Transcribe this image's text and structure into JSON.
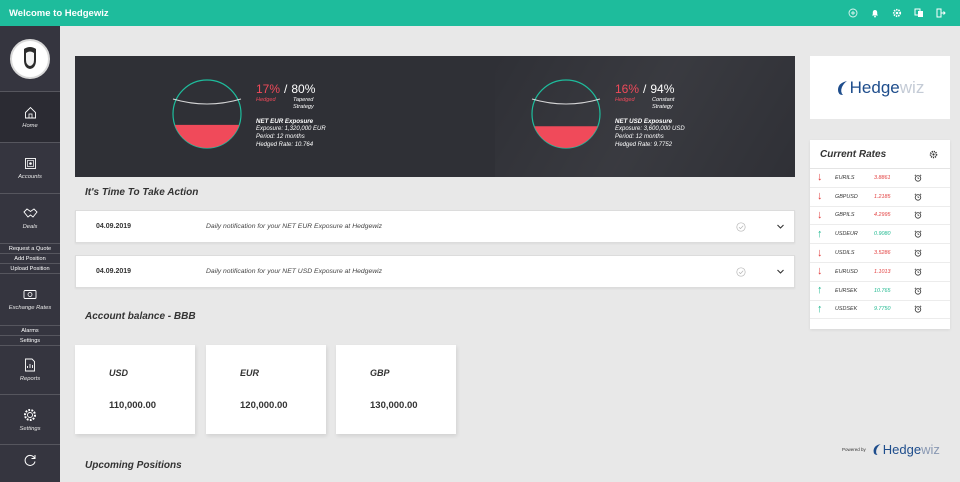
{
  "app": {
    "title": "Welcome to Hedgewiz"
  },
  "topbar_icons": [
    "add-circle-icon",
    "bell-icon",
    "gear-icon",
    "windows-icon",
    "logout-icon"
  ],
  "sidebar": {
    "items": [
      {
        "label": "Home",
        "icon": "home-icon",
        "active": true
      },
      {
        "label": "Accounts",
        "icon": "safe-icon"
      },
      {
        "label": "Deals",
        "icon": "handshake-icon"
      }
    ],
    "deal_sub": [
      "Request a Quote",
      "Add Position",
      "Upload Position"
    ],
    "exchange": {
      "label": "Exchange Rates",
      "icon": "money-icon"
    },
    "exchange_sub": [
      "Alarms",
      "Settings"
    ],
    "reports": {
      "label": "Reports",
      "icon": "report-icon"
    },
    "settings": {
      "label": "Settings",
      "icon": "gear-icon"
    }
  },
  "exposures": [
    {
      "hedged_pct": "17%",
      "strategy_pct": "80%",
      "hedged_label": "Hedged",
      "strategy_label": "Tapered Strategy",
      "gauge_fill": 0.17,
      "title": "NET EUR Exposure",
      "exposure": "Exposure: 1,320,000  EUR",
      "period": "Period: 12 months",
      "rate": "Hedged Rate: 10.764"
    },
    {
      "hedged_pct": "16%",
      "strategy_pct": "94%",
      "hedged_label": "Hedged",
      "strategy_label": "Constant Strategy",
      "gauge_fill": 0.16,
      "title": "NET USD Exposure",
      "exposure": "Exposure: 3,600,000  USD",
      "period": "Period: 12 months",
      "rate": "Hedged Rate: 9.7752"
    }
  ],
  "action": {
    "title": "It's Time To Take Action",
    "notifications": [
      {
        "date": "04.09.2019",
        "message": "Daily notification for your NET EUR Exposure at Hedgewiz"
      },
      {
        "date": "04.09.2019",
        "message": "Daily notification for your NET USD Exposure at Hedgewiz"
      }
    ]
  },
  "balance": {
    "title": "Account balance - BBB",
    "cards": [
      {
        "currency": "USD",
        "amount": "110,000.00"
      },
      {
        "currency": "EUR",
        "amount": "120,000.00"
      },
      {
        "currency": "GBP",
        "amount": "130,000.00"
      }
    ]
  },
  "upcoming": {
    "title": "Upcoming Positions"
  },
  "logo": {
    "main": "Hedge",
    "accent": "wiz"
  },
  "rates": {
    "title": "Current Rates",
    "rows": [
      {
        "pair": "EURILS",
        "value": "3.8861",
        "dir": "down"
      },
      {
        "pair": "GBPUSD",
        "value": "1.2185",
        "dir": "down"
      },
      {
        "pair": "GBPILS",
        "value": "4.2995",
        "dir": "down"
      },
      {
        "pair": "USDEUR",
        "value": "0.9080",
        "dir": "up"
      },
      {
        "pair": "USDILS",
        "value": "3.5286",
        "dir": "down"
      },
      {
        "pair": "EURUSD",
        "value": "1.1013",
        "dir": "down"
      },
      {
        "pair": "EURSEK",
        "value": "10.765",
        "dir": "up"
      },
      {
        "pair": "USDSEK",
        "value": "9.7750",
        "dir": "up"
      }
    ]
  },
  "powered": {
    "label": "Powered by",
    "brand_main": "Hedge",
    "brand_accent": "wiz"
  },
  "colors": {
    "topbar": "#1ebc9c",
    "sidebar": "#35353f",
    "hedged_red": "#f04a5a",
    "rate_down": "#e23c3c",
    "rate_up": "#1eb88f",
    "brand_blue": "#1e4d8c"
  }
}
